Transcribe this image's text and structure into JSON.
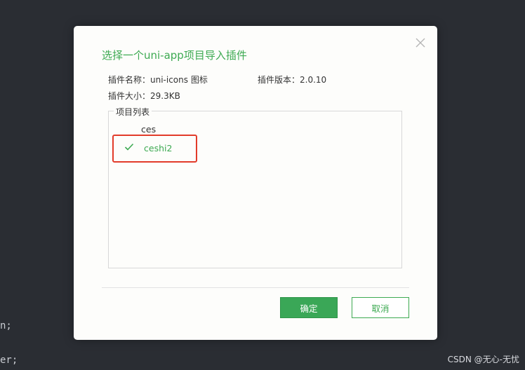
{
  "editor": {
    "line1": "n;",
    "line2": "er;"
  },
  "dialog": {
    "title": "选择一个uni-app项目导入插件",
    "plugin_name": "插件名称：uni-icons 图标",
    "plugin_version": "插件版本：2.0.10",
    "plugin_size": "插件大小：29.3KB",
    "project_list_label": "项目列表",
    "projects": [
      {
        "name": "ces",
        "selected": false
      },
      {
        "name": "ceshi2",
        "selected": true
      }
    ],
    "ok_label": "确定",
    "cancel_label": "取消"
  },
  "watermark": "CSDN @无心-无忧",
  "colors": {
    "accent": "#3daa52",
    "ok_button": "#3aa757",
    "highlight_border": "#e23b2a",
    "editor_bg": "#2a2d33"
  },
  "icons": {
    "close": "close-icon",
    "selected": "checkmark-icon"
  }
}
